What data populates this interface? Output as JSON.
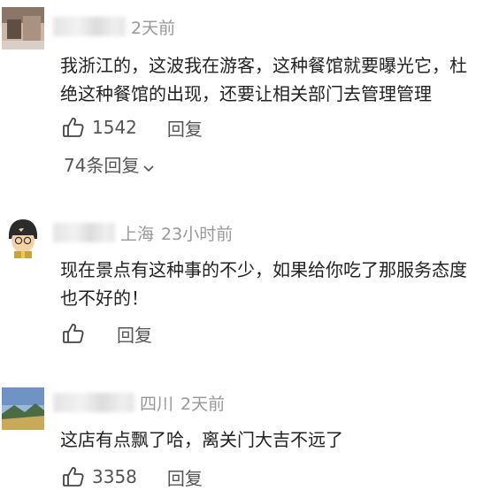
{
  "comments": [
    {
      "location": "",
      "time": "2天前",
      "text_line1": "我浙江的，这波我在游客，这种餐馆就要曝光它，杜",
      "text_line2": "绝这种餐馆的出现，还要让相关部门去管理管理",
      "likes": "1542",
      "reply_label": "回复",
      "replies_link": "74条回复"
    },
    {
      "location": "上海",
      "time": "23小时前",
      "text_line1": "现在景点有这种事的不少，如果给你吃了那服务态度",
      "text_line2": "也不好的！",
      "likes": "",
      "reply_label": "回复"
    },
    {
      "location": "四川",
      "time": "2天前",
      "text_line1": "这店有点飘了哈，离关门大吉不远了",
      "likes": "3358",
      "reply_label": "回复"
    }
  ],
  "icons": {
    "like": "thumbs-up-outline-icon",
    "expand": "chevron-down-icon"
  },
  "colors": {
    "text": "#222222",
    "meta": "#999999",
    "action": "#555555"
  }
}
